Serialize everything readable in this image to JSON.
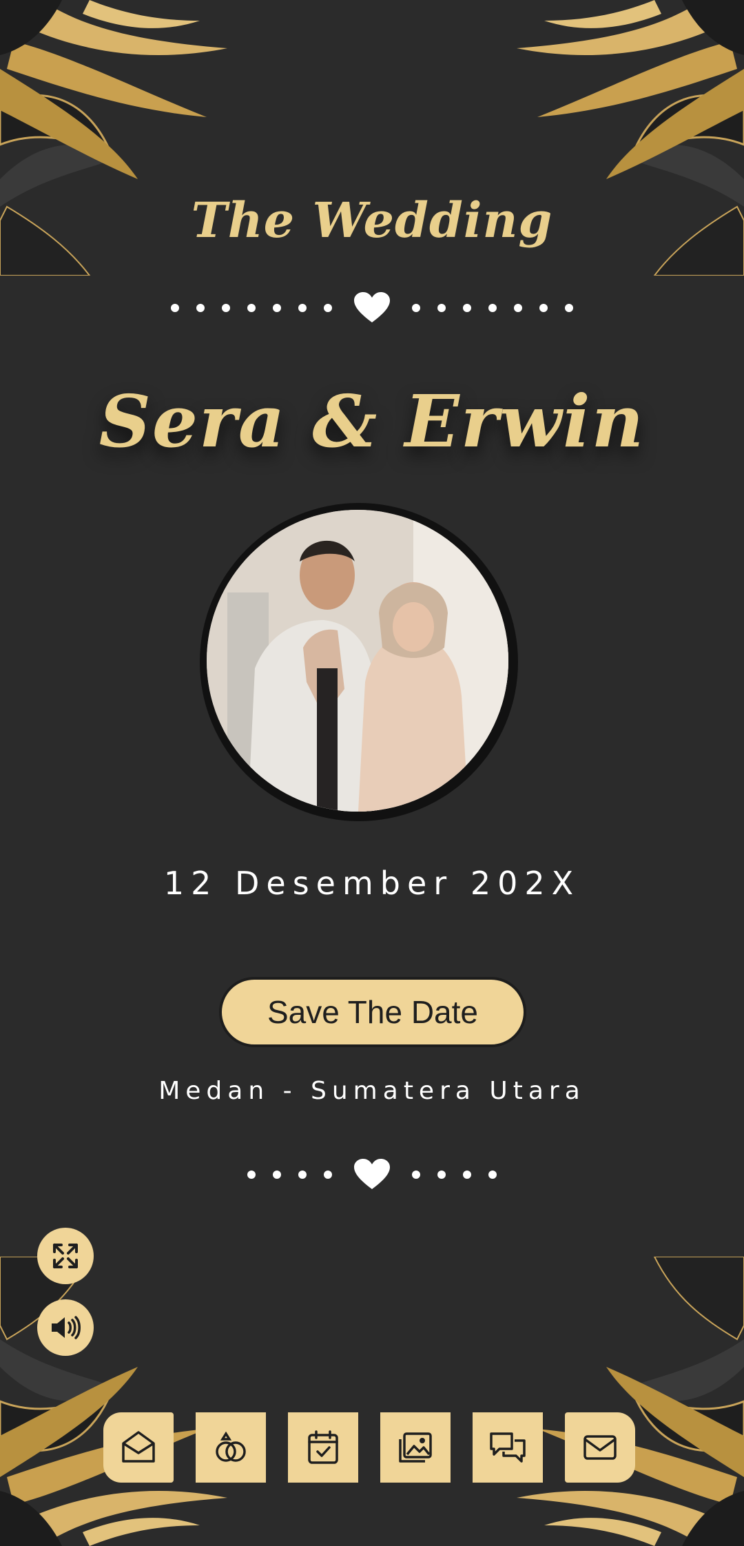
{
  "header": {
    "title": "The Wedding"
  },
  "couple": {
    "names": "Sera & Erwin"
  },
  "event": {
    "date": "12 Desember 202X",
    "save_label": "Save The Date",
    "location": "Medan - Sumatera Utara"
  },
  "controls": {
    "expand_icon": "expand-arrows-icon",
    "sound_icon": "volume-icon"
  },
  "nav": {
    "items": [
      {
        "icon": "envelope-open-icon"
      },
      {
        "icon": "rings-icon"
      },
      {
        "icon": "calendar-check-icon"
      },
      {
        "icon": "gallery-icon"
      },
      {
        "icon": "chat-icon"
      },
      {
        "icon": "mail-icon"
      }
    ]
  },
  "colors": {
    "background": "#2b2b2b",
    "gold": "#e9cf8c",
    "button": "#f0d598",
    "text": "#ffffff"
  }
}
